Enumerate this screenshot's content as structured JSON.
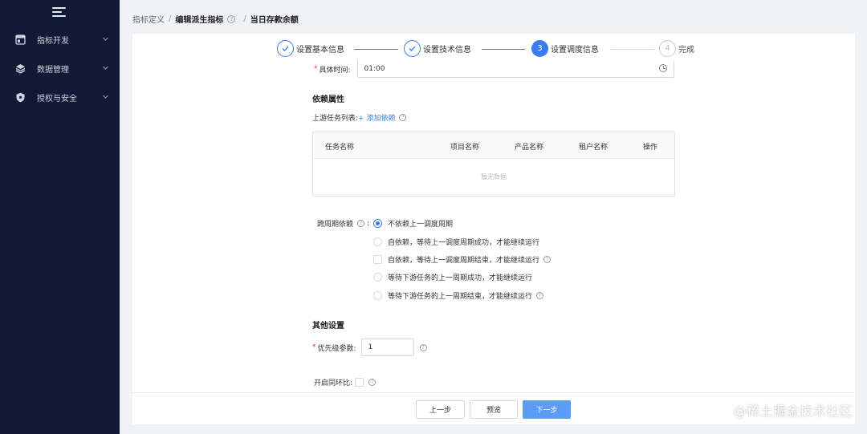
{
  "sidebar": {
    "items": [
      {
        "label": "指标开发",
        "icon": "dashboard-icon"
      },
      {
        "label": "数据管理",
        "icon": "layers-icon"
      },
      {
        "label": "授权与安全",
        "icon": "shield-icon"
      }
    ]
  },
  "breadcrumb": {
    "item1": "指标定义",
    "item2": "编辑派生指标",
    "item3": "当日存款余额",
    "sep": "/"
  },
  "steps": [
    {
      "label": "设置基本信息",
      "state": "done"
    },
    {
      "label": "设置技术信息",
      "state": "done"
    },
    {
      "number": "3",
      "label": "设置调度信息",
      "state": "active"
    },
    {
      "number": "4",
      "label": "完成",
      "state": "pending"
    }
  ],
  "form": {
    "time_label": "具体时间:",
    "time_value": "01:00",
    "dependency_title": "依赖属性",
    "upstream_label": "上游任务列表:",
    "add_dependency": "+ 添加依赖",
    "table": {
      "headers": [
        "任务名称",
        "项目名称",
        "产品名称",
        "租户名称",
        "操作"
      ],
      "empty_text": "暂无数据"
    },
    "cross_cycle_label": "跨周期依赖",
    "cross_cycle_colon": ":",
    "cross_cycle_options": [
      "不依赖上一调度周期",
      "自依赖，等待上一调度周期成功，才能继续运行",
      "自依赖，等待上一调度周期结束，才能继续运行",
      "等待下游任务的上一周期成功，才能继续运行",
      "等待下游任务的上一周期结束，才能继续运行"
    ],
    "cross_cycle_selected": 0,
    "other_title": "其他设置",
    "priority_label": "优先级参数:",
    "priority_value": "1",
    "ratio_label": "开启同环比:"
  },
  "footer": {
    "prev": "上一步",
    "preview": "预览",
    "next": "下一步"
  },
  "watermark": "@稀土掘金技术社区",
  "colors": {
    "sidebar_bg": "#111a35",
    "primary": "#3a7bf0",
    "button_primary": "#5a9cf8"
  }
}
